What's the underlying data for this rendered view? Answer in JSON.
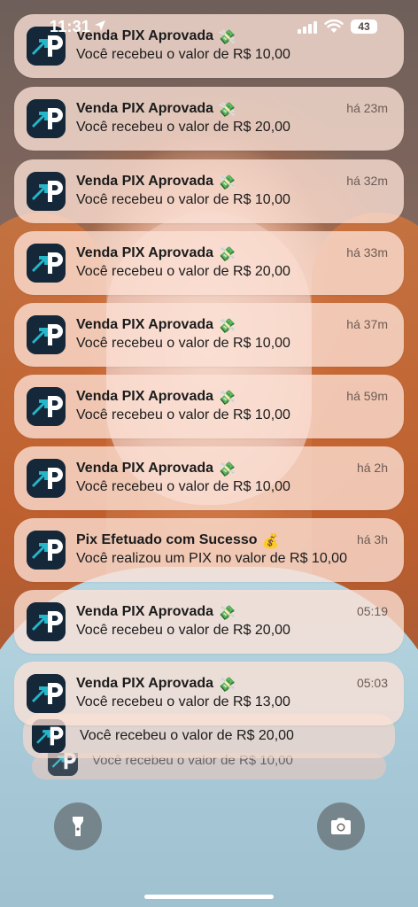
{
  "status_bar": {
    "time": "11:31",
    "battery": "43"
  },
  "notifications": [
    {
      "title": "Venda PIX Aprovada",
      "emoji": "💸",
      "body": "Você recebeu o valor de R$ 10,00",
      "time": ""
    },
    {
      "title": "Venda PIX Aprovada",
      "emoji": "💸",
      "body": "Você recebeu o valor de R$ 20,00",
      "time": "há 23m"
    },
    {
      "title": "Venda PIX Aprovada",
      "emoji": "💸",
      "body": "Você recebeu o valor de R$ 10,00",
      "time": "há 32m"
    },
    {
      "title": "Venda PIX Aprovada",
      "emoji": "💸",
      "body": "Você recebeu o valor de R$ 20,00",
      "time": "há 33m"
    },
    {
      "title": "Venda PIX Aprovada",
      "emoji": "💸",
      "body": "Você recebeu o valor de R$ 10,00",
      "time": "há 37m"
    },
    {
      "title": "Venda PIX Aprovada",
      "emoji": "💸",
      "body": "Você recebeu o valor de R$ 10,00",
      "time": "há 59m"
    },
    {
      "title": "Venda PIX Aprovada",
      "emoji": "💸",
      "body": "Você recebeu o valor de R$ 10,00",
      "time": "há 2h"
    },
    {
      "title": "Pix Efetuado com Sucesso",
      "emoji": "💰",
      "body": "Você realizou um PIX no valor de R$ 10,00",
      "time": "há 3h"
    },
    {
      "title": "Venda PIX Aprovada",
      "emoji": "💸",
      "body": "Você recebeu o valor de R$ 20,00",
      "time": "05:19"
    },
    {
      "title": "Venda PIX Aprovada",
      "emoji": "💸",
      "body": "Você recebeu o valor de R$ 13,00",
      "time": "05:03"
    }
  ],
  "stacked": [
    {
      "body": "Você recebeu o valor de R$ 20,00"
    },
    {
      "body": "Você recebeu o valor de R$ 10,00"
    }
  ],
  "icons": {
    "app": "cp-logo-icon",
    "location": "location-arrow-icon",
    "signal": "cellular-signal-icon",
    "wifi": "wifi-icon",
    "flashlight": "flashlight-icon",
    "camera": "camera-icon"
  },
  "colors": {
    "app_icon_bg": "#15283a",
    "app_icon_accent": "#24b6c9"
  }
}
